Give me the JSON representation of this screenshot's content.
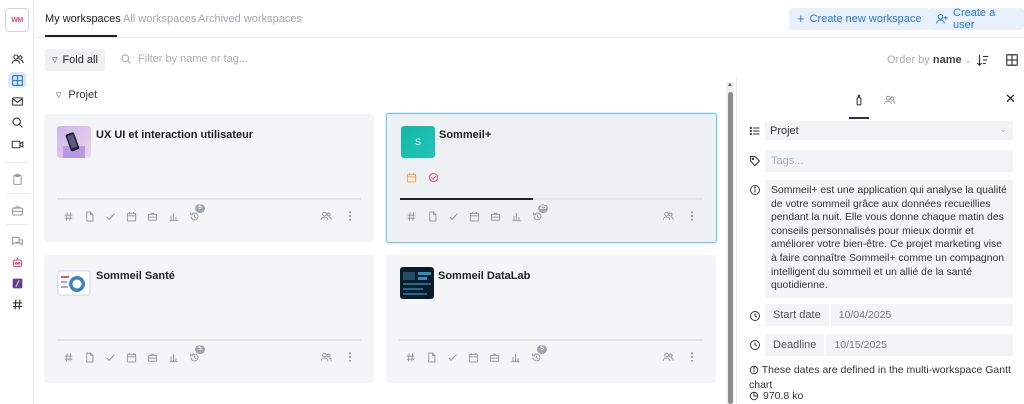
{
  "app": {
    "logo_text": "WM"
  },
  "header": {
    "tabs": [
      {
        "label": "My workspaces",
        "active": true
      },
      {
        "label": "All workspaces",
        "active": false
      },
      {
        "label": "Archived workspaces",
        "active": false
      }
    ],
    "create_workspace_label": "Create new workspace",
    "create_user_label": "Create a user"
  },
  "toolbar": {
    "fold_label": "Fold all",
    "filter_placeholder": "Filter by name or tag...",
    "order_prefix": "Order by",
    "order_value": "name"
  },
  "section": {
    "label": "Projet"
  },
  "cards": [
    {
      "title": "UX UI et interaction utilisateur",
      "history_badge": "5",
      "progress": 0
    },
    {
      "title": "Sommeil+",
      "thumb_letter": "S",
      "history_badge": "25",
      "progress": 0.44,
      "selected": true
    },
    {
      "title": "Sommeil Santé",
      "history_badge": "5",
      "progress": 0
    },
    {
      "title": "Sommeil DataLab",
      "history_badge": "5",
      "progress": 0
    }
  ],
  "panel": {
    "type_value": "Projet",
    "tags_placeholder": "Tags...",
    "description": "Sommeil+ est une application qui analyse la qualité de votre sommeil grâce aux données recueillies pendant la nuit. Elle vous donne chaque matin des conseils personnalisés pour mieux dormir et améliorer votre bien-être. Ce projet marketing vise à faire connaître Sommeil+ comme un compagnon intelligent du sommeil et un allié de la santé quotidienne.",
    "start_date_label": "Start date",
    "start_date_value": "10/04/2025",
    "deadline_label": "Deadline",
    "deadline_value": "10/15/2025",
    "note": "These dates are defined in the multi-workspace Gantt chart",
    "size": "970.8 ko"
  },
  "colors": {
    "accent": "#2b7bd6",
    "selected_border": "#7cc7e6",
    "sommeil_plus": "#1fb5ad"
  }
}
